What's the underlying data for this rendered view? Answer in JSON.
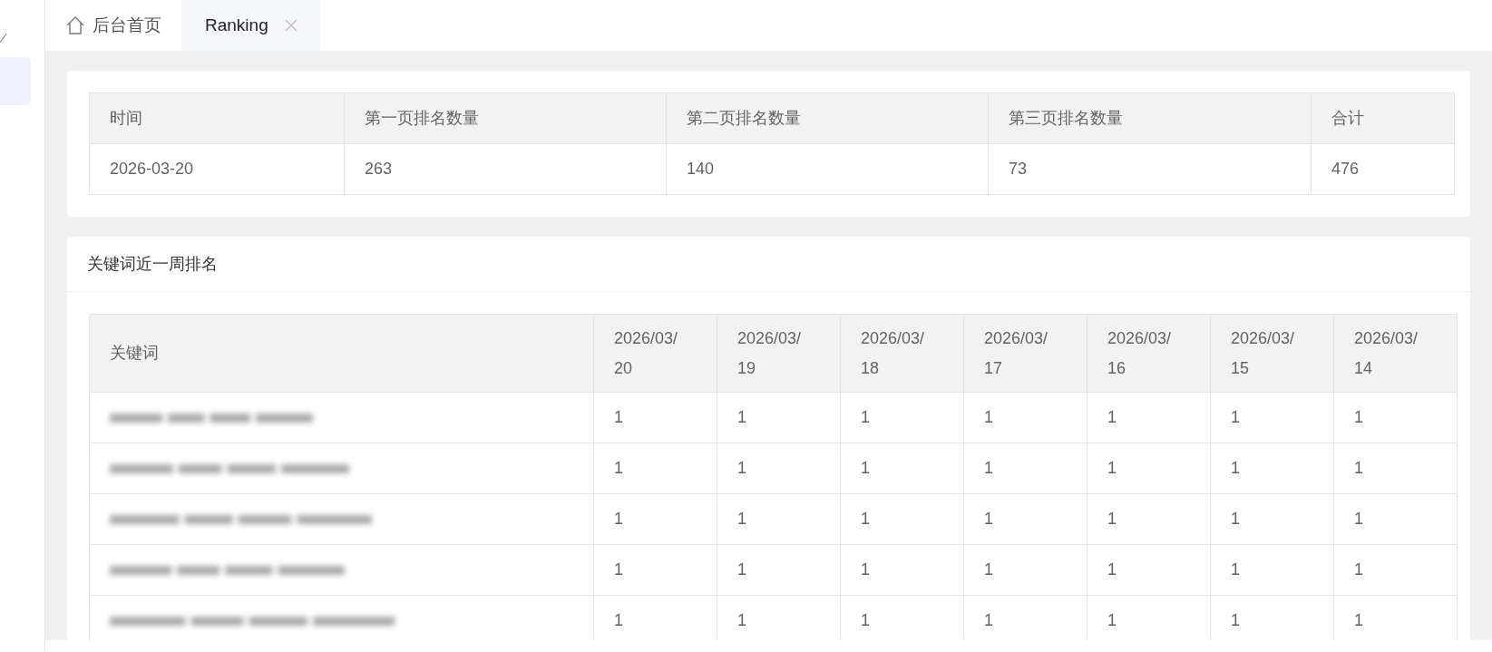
{
  "tabs": [
    {
      "label": "后台首页",
      "kind": "home",
      "selected": false
    },
    {
      "label": "Ranking",
      "kind": "closable",
      "selected": true
    }
  ],
  "summary_table": {
    "columns": [
      "时间",
      "第一页排名数量",
      "第二页排名数量",
      "第三页排名数量",
      "合计"
    ],
    "rows": [
      [
        "2026-03-20",
        "263",
        "140",
        "73",
        "476"
      ]
    ]
  },
  "weekly_card": {
    "title": "关键词近一周排名",
    "table": {
      "columns": [
        "关键词",
        "2026/03/20",
        "2026/03/19",
        "2026/03/18",
        "2026/03/17",
        "2026/03/16",
        "2026/03/15",
        "2026/03/14"
      ],
      "rows": [
        {
          "values": [
            "1",
            "1",
            "1",
            "1",
            "1",
            "1",
            "1"
          ]
        },
        {
          "values": [
            "1",
            "1",
            "1",
            "1",
            "1",
            "1",
            "1"
          ]
        },
        {
          "values": [
            "1",
            "1",
            "1",
            "1",
            "1",
            "1",
            "1"
          ]
        },
        {
          "values": [
            "1",
            "1",
            "1",
            "1",
            "1",
            "1",
            "1"
          ]
        },
        {
          "values": [
            "1",
            "1",
            "1",
            "1",
            "1",
            "1",
            "1"
          ]
        }
      ]
    }
  }
}
